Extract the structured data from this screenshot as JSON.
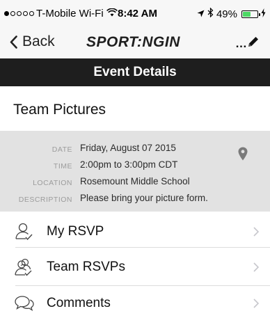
{
  "status_bar": {
    "carrier": "T-Mobile Wi-Fi",
    "time": "8:42 AM",
    "battery": "49%",
    "battery_level": 0.49,
    "signal_bars_filled": 1,
    "signal_bars_total": 5
  },
  "nav": {
    "back_label": "Back",
    "logo_text": "SPORT:NGIN",
    "edit_icon": "pencil-icon"
  },
  "header": {
    "title": "Event Details"
  },
  "event": {
    "title": "Team Pictures"
  },
  "details": {
    "date_label": "DATE",
    "date_value": "Friday, August 07 2015",
    "time_label": "TIME",
    "time_value": "2:00pm to 3:00pm CDT",
    "location_label": "LOCATION",
    "location_value": "Rosemount Middle School",
    "description_label": "DESCRIPTION",
    "description_value": "Please bring your picture form."
  },
  "menu": {
    "items": [
      {
        "label": "My RSVP",
        "icon": "person-icon"
      },
      {
        "label": "Team RSVPs",
        "icon": "people-icon"
      },
      {
        "label": "Comments",
        "icon": "chat-bubbles-icon"
      }
    ]
  },
  "colors": {
    "header_bg": "#1e1e1e",
    "details_bg": "#e2e2e2",
    "battery_fill": "#4cd964"
  }
}
